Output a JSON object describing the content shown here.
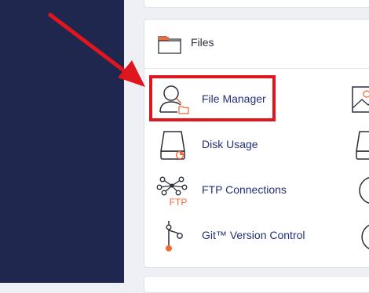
{
  "files_panel": {
    "title": "Files",
    "items": [
      {
        "label": "File Manager",
        "icon": "file-manager-icon"
      },
      {
        "label": "Disk Usage",
        "icon": "disk-usage-icon"
      },
      {
        "label": "FTP Connections",
        "icon": "ftp-connections-icon",
        "icon_text": "FTP"
      },
      {
        "label": "Git™ Version Control",
        "icon": "git-icon"
      }
    ]
  },
  "annotation": {
    "arrow_color": "#e0161f",
    "highlight_color": "#e0161f"
  },
  "colors": {
    "sidebar": "#20274e",
    "link": "#24307a",
    "accent": "#f26b35",
    "background": "#eef0f5"
  }
}
